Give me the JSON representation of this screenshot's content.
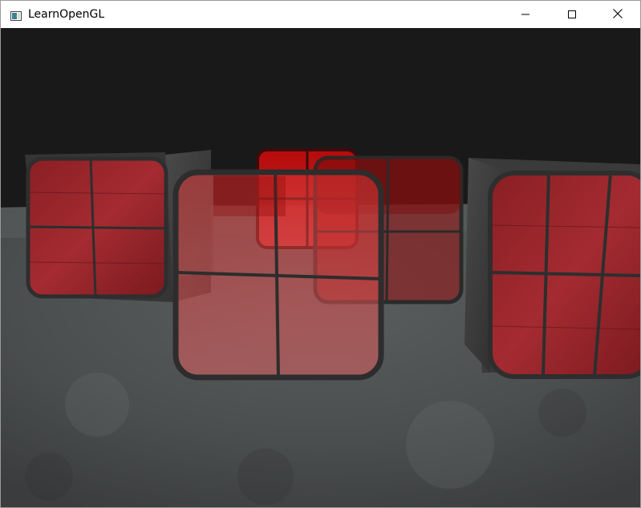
{
  "window": {
    "title": "LearnOpenGL",
    "controls": {
      "minimize": "minimize-icon",
      "maximize": "maximize-icon",
      "close": "close-icon"
    }
  },
  "scene": {
    "description_hidden": "",
    "clear_color": "#191919",
    "floor_color": "#4f5253",
    "cube_color": "#3a3a3a",
    "window_tint": "#c21818",
    "window_frame_color": "#2f2f2f"
  }
}
